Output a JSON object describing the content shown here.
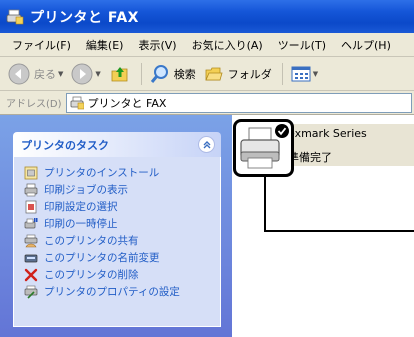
{
  "window": {
    "title": "プリンタと FAX"
  },
  "menubar": {
    "items": [
      "ファイル(F)",
      "編集(E)",
      "表示(V)",
      "お気に入り(A)",
      "ツール(T)",
      "ヘルプ(H)"
    ]
  },
  "toolbar": {
    "back_label": "戻る",
    "search_label": "検索",
    "folder_label": "フォルダ"
  },
  "address": {
    "label": "アドレス(D)",
    "value": "プリンタと FAX"
  },
  "tasks": {
    "header": "プリンタのタスク",
    "items": [
      {
        "label": "プリンタのインストール",
        "icon": "add-printer-icon"
      },
      {
        "label": "印刷ジョブの表示",
        "icon": "print-queue-icon"
      },
      {
        "label": "印刷設定の選択",
        "icon": "print-settings-icon"
      },
      {
        "label": "印刷の一時停止",
        "icon": "pause-printing-icon"
      },
      {
        "label": "このプリンタの共有",
        "icon": "share-printer-icon"
      },
      {
        "label": "このプリンタの名前変更",
        "icon": "rename-printer-icon"
      },
      {
        "label": "このプリンタの削除",
        "icon": "delete-icon"
      },
      {
        "label": "プリンタのプロパティの設定",
        "icon": "properties-icon"
      }
    ]
  },
  "printer": {
    "name": "exmark Series",
    "status": "準備完了",
    "default": true
  },
  "colors": {
    "titlebar": "#0b49c9",
    "task_pane": "#6375d6",
    "task_link": "#215dc6",
    "chrome": "#ece9d8"
  }
}
